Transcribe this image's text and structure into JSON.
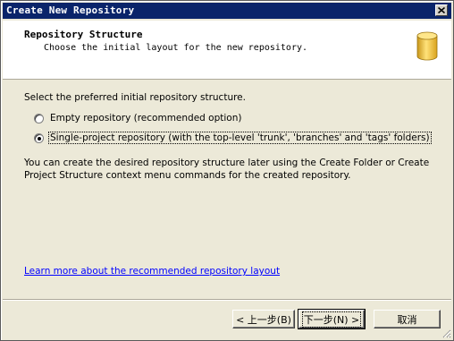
{
  "window": {
    "title": "Create New Repository",
    "close_glyph": "✕"
  },
  "header": {
    "title": "Repository Structure",
    "subtitle": "Choose the initial layout for the new repository.",
    "icon": "database-icon",
    "icon_color": "#f5c518"
  },
  "main": {
    "prompt": "Select the preferred initial repository structure.",
    "options": [
      {
        "label": "Empty repository (recommended option)",
        "checked": false
      },
      {
        "label": "Single-project repository (with the top-level 'trunk', 'branches' and 'tags' folders)",
        "checked": true
      }
    ],
    "info": "You can create the desired repository structure later using the Create Folder or Create Project Structure context menu commands for the created repository.",
    "link": "Learn more about the recommended repository layout"
  },
  "buttons": {
    "back": "< 上一步(B)",
    "next": "下一步(N) >",
    "cancel": "取消"
  }
}
